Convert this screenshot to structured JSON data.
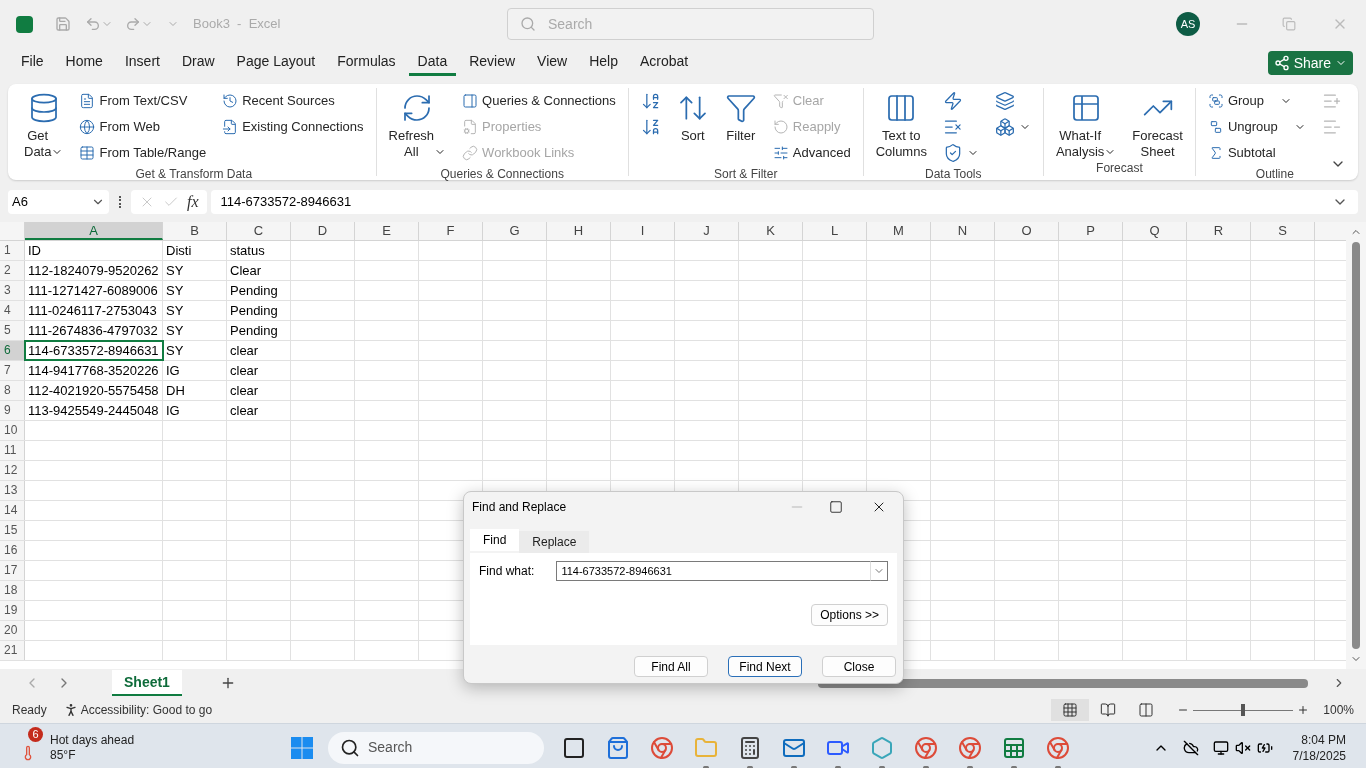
{
  "title_bar": {
    "title": "Book3  -  Excel",
    "search_placeholder": "Search",
    "avatar": "AS"
  },
  "menu_tabs": [
    {
      "label": "File",
      "selected": false
    },
    {
      "label": "Home",
      "selected": false
    },
    {
      "label": "Insert",
      "selected": false
    },
    {
      "label": "Draw",
      "selected": false
    },
    {
      "label": "Page Layout",
      "selected": false
    },
    {
      "label": "Formulas",
      "selected": false
    },
    {
      "label": "Data",
      "selected": true
    },
    {
      "label": "Review",
      "selected": false
    },
    {
      "label": "View",
      "selected": false
    },
    {
      "label": "Help",
      "selected": false
    },
    {
      "label": "Acrobat",
      "selected": false
    }
  ],
  "share_button": "Share",
  "ribbon_groups": [
    {
      "title": "Get & Transform Data",
      "columns": [
        [
          {
            "kind": "large",
            "label": "Get Data",
            "dropdown": true,
            "disabled": false
          }
        ],
        [
          {
            "kind": "small",
            "label": "From Text/CSV",
            "dropdown": false,
            "disabled": false
          },
          {
            "kind": "small",
            "label": "From Web",
            "dropdown": false,
            "disabled": false
          },
          {
            "kind": "small",
            "label": "From Table/Range",
            "dropdown": false,
            "disabled": false
          }
        ],
        [
          {
            "kind": "small",
            "label": "Recent Sources",
            "dropdown": false,
            "disabled": false
          },
          {
            "kind": "small",
            "label": "Existing Connections",
            "dropdown": false,
            "disabled": false
          }
        ]
      ]
    },
    {
      "title": "Queries & Connections",
      "columns": [
        [
          {
            "kind": "large",
            "label": "Refresh All",
            "dropdown": true,
            "disabled": false
          }
        ],
        [
          {
            "kind": "small",
            "label": "Queries & Connections",
            "dropdown": false,
            "disabled": false
          },
          {
            "kind": "small",
            "label": "Properties",
            "dropdown": false,
            "disabled": true
          },
          {
            "kind": "small",
            "label": "Workbook Links",
            "dropdown": false,
            "disabled": true
          }
        ]
      ]
    },
    {
      "title": "Sort & Filter",
      "columns": [
        [
          {
            "kind": "icon",
            "dropdown": false,
            "disabled": false
          },
          {
            "kind": "icon",
            "dropdown": false,
            "disabled": false
          }
        ],
        [
          {
            "kind": "large",
            "label": "Sort",
            "dropdown": false,
            "disabled": false
          }
        ],
        [
          {
            "kind": "large",
            "label": "Filter",
            "dropdown": false,
            "disabled": false
          }
        ],
        [
          {
            "kind": "small",
            "label": "Clear",
            "dropdown": false,
            "disabled": true
          },
          {
            "kind": "small",
            "label": "Reapply",
            "dropdown": false,
            "disabled": true
          },
          {
            "kind": "small",
            "label": "Advanced",
            "dropdown": false,
            "disabled": false
          }
        ]
      ]
    },
    {
      "title": "Data Tools",
      "columns": [
        [
          {
            "kind": "large",
            "label": "Text to Columns",
            "dropdown": false,
            "disabled": false
          }
        ],
        [
          {
            "kind": "icon",
            "dropdown": false,
            "disabled": false
          },
          {
            "kind": "icon",
            "dropdown": false,
            "disabled": false
          },
          {
            "kind": "icon",
            "dropdown": true,
            "disabled": false
          }
        ],
        [
          {
            "kind": "icon",
            "dropdown": false,
            "disabled": false
          },
          {
            "kind": "icon",
            "dropdown": true,
            "disabled": false
          }
        ]
      ]
    },
    {
      "title": "Forecast",
      "columns": [
        [
          {
            "kind": "large",
            "label": "What-If Analysis",
            "dropdown": true,
            "disabled": false
          }
        ],
        [
          {
            "kind": "large",
            "label": "Forecast Sheet",
            "dropdown": false,
            "disabled": false
          }
        ]
      ]
    },
    {
      "title": "Outline",
      "columns": [
        [
          {
            "kind": "small",
            "label": "Group",
            "dropdown": true,
            "disabled": false
          },
          {
            "kind": "small",
            "label": "Ungroup",
            "dropdown": true,
            "disabled": false
          },
          {
            "kind": "small",
            "label": "Subtotal",
            "dropdown": false,
            "disabled": false
          }
        ],
        [
          {
            "kind": "icon",
            "dropdown": false,
            "disabled": true
          },
          {
            "kind": "icon",
            "dropdown": false,
            "disabled": true
          }
        ]
      ]
    }
  ],
  "formula_bar": {
    "name_box": "A6",
    "function_label": "fx",
    "formula": "114-6733572-8946631"
  },
  "columns": [
    {
      "letter": "A",
      "selected": true
    },
    {
      "letter": "B",
      "selected": false
    },
    {
      "letter": "C",
      "selected": false
    },
    {
      "letter": "D",
      "selected": false
    },
    {
      "letter": "E",
      "selected": false
    },
    {
      "letter": "F",
      "selected": false
    },
    {
      "letter": "G",
      "selected": false
    },
    {
      "letter": "H",
      "selected": false
    },
    {
      "letter": "I",
      "selected": false
    },
    {
      "letter": "J",
      "selected": false
    },
    {
      "letter": "K",
      "selected": false
    },
    {
      "letter": "L",
      "selected": false
    },
    {
      "letter": "M",
      "selected": false
    },
    {
      "letter": "N",
      "selected": false
    },
    {
      "letter": "O",
      "selected": false
    },
    {
      "letter": "P",
      "selected": false
    },
    {
      "letter": "Q",
      "selected": false
    },
    {
      "letter": "R",
      "selected": false
    },
    {
      "letter": "S",
      "selected": false
    }
  ],
  "rows": [
    {
      "number": "1",
      "selected": false,
      "cells": [
        "ID",
        "Disti",
        "status"
      ]
    },
    {
      "number": "2",
      "selected": false,
      "cells": [
        "112-1824079-9520262",
        "SY",
        "Clear"
      ]
    },
    {
      "number": "3",
      "selected": false,
      "cells": [
        "111-1271427-6089006",
        "SY",
        "Pending"
      ]
    },
    {
      "number": "4",
      "selected": false,
      "cells": [
        "111-0246117-2753043",
        "SY",
        "Pending"
      ]
    },
    {
      "number": "5",
      "selected": false,
      "cells": [
        "111-2674836-4797032",
        "SY",
        "Pending"
      ]
    },
    {
      "number": "6",
      "selected": true,
      "cells": [
        "114-6733572-8946631",
        "SY",
        "clear"
      ]
    },
    {
      "number": "7",
      "selected": false,
      "cells": [
        "114-9417768-3520226",
        "IG",
        "clear"
      ]
    },
    {
      "number": "8",
      "selected": false,
      "cells": [
        "112-4021920-5575458",
        "DH",
        "clear"
      ]
    },
    {
      "number": "9",
      "selected": false,
      "cells": [
        "113-9425549-2445048",
        "IG",
        "clear"
      ]
    },
    {
      "number": "10",
      "selected": false
    },
    {
      "number": "11",
      "selected": false
    },
    {
      "number": "12",
      "selected": false
    },
    {
      "number": "13",
      "selected": false
    },
    {
      "number": "14",
      "selected": false
    },
    {
      "number": "15",
      "selected": false
    },
    {
      "number": "16",
      "selected": false
    },
    {
      "number": "17",
      "selected": false
    },
    {
      "number": "18",
      "selected": false
    },
    {
      "number": "19",
      "selected": false
    },
    {
      "number": "20",
      "selected": false
    },
    {
      "number": "21",
      "selected": false
    }
  ],
  "sheet_tabs": [
    {
      "label": "Sheet1",
      "selected": true
    }
  ],
  "status_bar": {
    "ready": "Ready",
    "accessibility": "Accessibility: Good to go",
    "views": [
      {
        "kind": "normal",
        "selected": true
      },
      {
        "kind": "page_layout",
        "selected": false
      },
      {
        "kind": "page_break",
        "selected": false
      }
    ],
    "zoom": {
      "level": 0.5,
      "reading": "100%"
    }
  },
  "dialog": {
    "title": "Find and Replace",
    "tabs": [
      {
        "label": "Find",
        "selected": true
      },
      {
        "label": "Replace",
        "selected": false
      }
    ],
    "field_label": "Find what:",
    "field_value": "114-6733572-8946631",
    "options_button": "Options >>",
    "buttons": [
      {
        "label": "Find All",
        "default": false
      },
      {
        "label": "Find Next",
        "default": true
      },
      {
        "label": "Close",
        "default": false
      }
    ]
  },
  "taskbar": {
    "weather_badge": "6",
    "weather_title": "Hot days ahead",
    "weather_temp": "85°F",
    "search_placeholder": "Search",
    "apps": [
      {
        "kind": "taskview",
        "running": false
      },
      {
        "kind": "store",
        "running": false
      },
      {
        "kind": "browser",
        "running": false
      },
      {
        "kind": "files",
        "running": true
      },
      {
        "kind": "calculator",
        "running": true
      },
      {
        "kind": "mail",
        "running": true
      },
      {
        "kind": "meeting",
        "running": true
      },
      {
        "kind": "app",
        "running": true
      },
      {
        "kind": "browser",
        "running": true
      },
      {
        "kind": "browser",
        "running": true
      },
      {
        "kind": "spreadsheet",
        "running": true
      },
      {
        "kind": "browser",
        "running": true
      }
    ],
    "time": "8:04 PM",
    "date": "7/18/2025"
  }
}
